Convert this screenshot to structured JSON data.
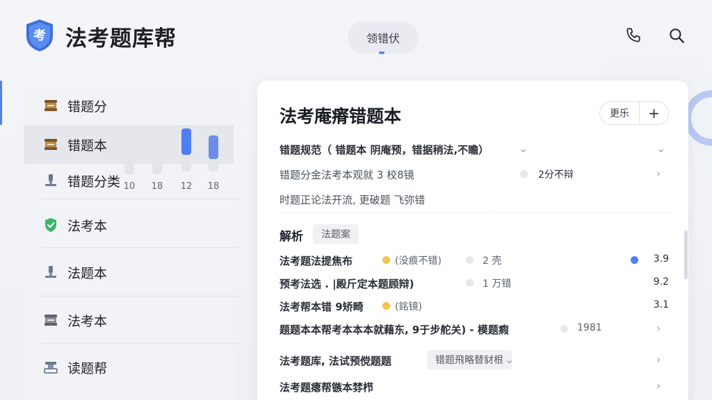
{
  "header": {
    "app_title": "法考题库帮",
    "logo_char": "考",
    "center_tab": "领错伏",
    "icons": [
      "phone-icon",
      "search-icon"
    ]
  },
  "sidebar": {
    "items": [
      {
        "label": "错题分",
        "icon": "scroll-icon"
      },
      {
        "label": "错题本",
        "icon": "scroll-icon"
      },
      {
        "label": "错题分类",
        "icon": "gavel-icon"
      },
      {
        "label": "法考本",
        "icon": "shield-check-icon"
      },
      {
        "label": "法题本",
        "icon": "gavel-icon"
      },
      {
        "label": "法考本",
        "icon": "scroll-icon"
      },
      {
        "label": "读题帮",
        "icon": "stamp-icon"
      }
    ],
    "mini_chart": {
      "ticks": [
        "10",
        "18",
        "12",
        "18"
      ]
    }
  },
  "card": {
    "title": "法考庵瘠错题本",
    "more_button": "更乐",
    "add_button": "+",
    "rows_top": [
      {
        "text": "错题规范（ 错题本    阴庵预，错据稍法,不瞻）",
        "bold": true
      },
      {
        "text": "错题分金法考本观就 3 校8镜",
        "sub": "2分不辩"
      },
      {
        "text": "时题正论法开流, 更破题 飞弥错"
      }
    ],
    "section_label": "解析",
    "section_tag": "法题案",
    "rows_mid": [
      {
        "text": "法考题法提焦布",
        "sub1": "(没痕不错)",
        "sub2": "2 壳",
        "value": "3.9"
      },
      {
        "text": "预考法选 . |殿斤定本题顾辩)",
        "sub2": "1 万错",
        "value": "9.2"
      },
      {
        "text": "法考帮本错 9矫畸",
        "sub1": "(銘镜)",
        "value": "3.1"
      },
      {
        "text": "题题本本帮考本本本就藉东, 9于步舵关) - 模题瘕",
        "sub2": "1981"
      }
    ],
    "rows_bottom": [
      {
        "text": "法考题库, 法试预傥题题",
        "tag": "错题飛略替豺根"
      },
      {
        "text": "法考题瘪帮镞本棼栉"
      }
    ]
  },
  "colors": {
    "accent": "#4f7ff0",
    "yellow_dot": "#f2c14e",
    "bar_blue": "#4f7ff0",
    "bar_light": "#e3e5ea"
  }
}
